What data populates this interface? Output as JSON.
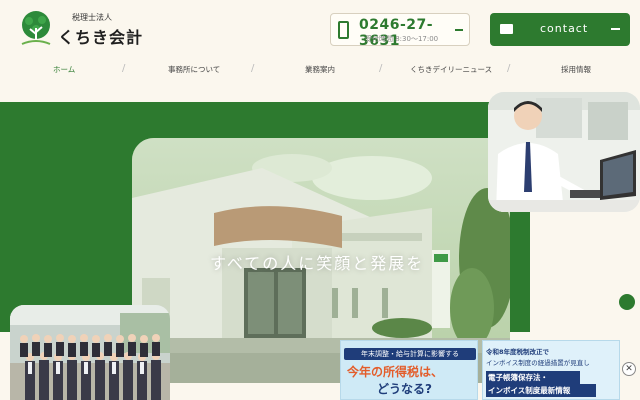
{
  "brand": {
    "subtitle": "税理士法人",
    "name": "くちき会計"
  },
  "phone": {
    "number": "0246-27-3631",
    "hours": "受付時間 8:30〜17:00"
  },
  "contact": {
    "label": "contact"
  },
  "nav": {
    "items": [
      {
        "label": "ホーム",
        "active": true
      },
      {
        "label": "事務所について",
        "active": false
      },
      {
        "label": "業務案内",
        "active": false
      },
      {
        "label": "くちきデイリーニュース",
        "active": false
      },
      {
        "label": "採用情報",
        "active": false
      }
    ]
  },
  "hero": {
    "tagline": "すべての人に笑顔と発展を"
  },
  "banners": {
    "tax": {
      "line1": "年末調整・給与計算に影響する",
      "line2": "今年の所得税は、",
      "line3": "どうなる?"
    },
    "invoice": {
      "line1": "令和8年度税制改正で",
      "line2": "インボイス制度の経過措置が見直し",
      "line3": "電子帳簿保存法・",
      "line4": "インボイス制度最新情報"
    }
  },
  "colors": {
    "brand_green": "#2d7a2f",
    "background": "#fbf7ee",
    "banner_navy": "#1f3d7a",
    "banner_orange": "#e35d2b"
  }
}
